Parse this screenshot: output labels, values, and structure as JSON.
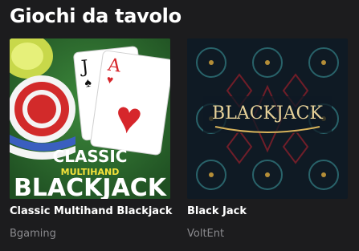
{
  "section": {
    "title": "Giochi da tavolo"
  },
  "games": [
    {
      "name": "Classic Multihand Blackjack",
      "provider": "Bgaming",
      "art": {
        "line1": "CLASSIC",
        "line2": "MULTIHAND",
        "line3": "BLACKJACK",
        "card1": "J",
        "card2": "A",
        "bg": "#2b6a2e"
      }
    },
    {
      "name": "Black Jack",
      "provider": "VoltEnt",
      "art": {
        "logo": "BLACKJACK",
        "bg": "#0f1a24"
      }
    }
  ]
}
